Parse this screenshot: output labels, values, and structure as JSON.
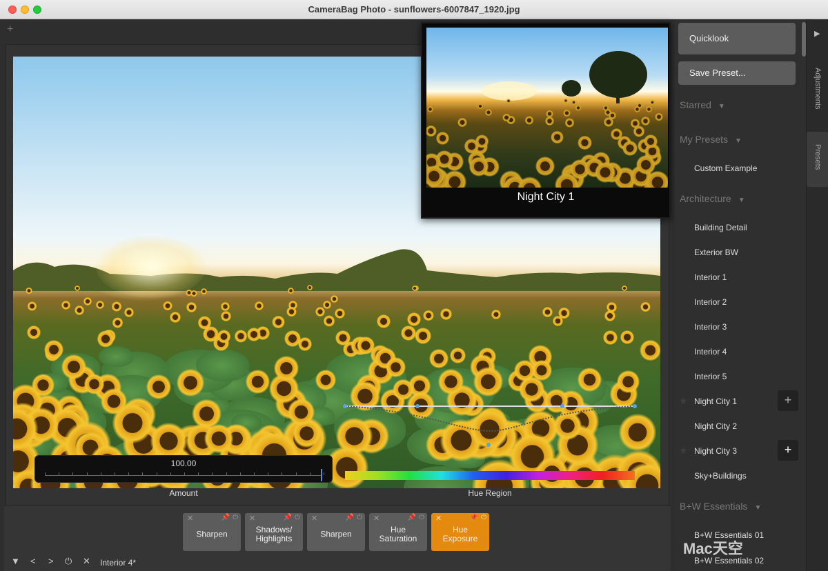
{
  "window": {
    "title": "CameraBag Photo - sunflowers-6007847_1920.jpg"
  },
  "editor": {
    "new_tab": "+",
    "amount": {
      "value": "100.00",
      "label": "Amount"
    },
    "hue_region": {
      "label": "Hue Region"
    }
  },
  "preview": {
    "title": "Night City 1"
  },
  "chain": {
    "cards": [
      {
        "label": "Sharpen",
        "active": false
      },
      {
        "label": "Shadows/\nHighlights",
        "active": false
      },
      {
        "label": "Sharpen",
        "active": false
      },
      {
        "label": "Hue\nSaturation",
        "active": false
      },
      {
        "label": "Hue\nExposure",
        "active": true
      }
    ],
    "close_glyph": "✕",
    "pin_glyph": "📌",
    "power_glyph": "⏻",
    "controls": {
      "collapse": "▼",
      "prev": "<",
      "next": ">",
      "power": "⏻",
      "close": "✕"
    },
    "current_preset": "Interior 4*"
  },
  "right_panel": {
    "quicklook": "Quicklook",
    "save_preset": "Save Preset...",
    "sections": {
      "starred": "Starred",
      "my_presets": "My Presets",
      "architecture": "Architecture",
      "bw": "B+W Essentials"
    },
    "my_presets": [
      "Custom Example"
    ],
    "architecture": [
      "Building Detail",
      "Exterior BW",
      "Interior 1",
      "Interior 2",
      "Interior 3",
      "Interior 4",
      "Interior 5",
      "Night City 1",
      "Night City 2",
      "Night City 3",
      "Sky+Buildings"
    ],
    "bw": [
      "B+W Essentials 01",
      "B+W Essentials 02"
    ],
    "add_glyph": "+",
    "star_glyph": "★",
    "caret_glyph": "▼"
  },
  "tabs": {
    "arrow": "▶",
    "adjustments": "Adjustments",
    "presets": "Presets"
  },
  "watermark": "Mac天空"
}
